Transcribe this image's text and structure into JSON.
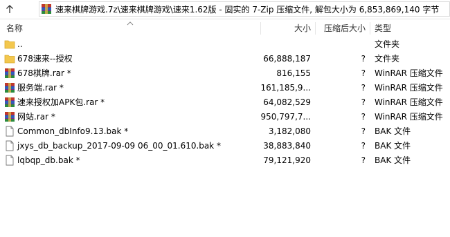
{
  "window": {
    "path": "速来棋牌游戏.7z\\速来棋牌游戏\\速来1.62版 - 固实的 7-Zip 压缩文件, 解包大小为 6,853,869,140 字节",
    "up_icon": "up-arrow-icon",
    "archive_icon": "winrar-archive-icon"
  },
  "columns": {
    "name": "名称",
    "size": "大小",
    "packed": "压缩后大小",
    "type": "类型"
  },
  "rows": [
    {
      "name": "..",
      "size": "",
      "packed": "",
      "type": "文件夹",
      "icon": "folder-icon"
    },
    {
      "name": "678速来--授权",
      "size": "66,888,187",
      "packed": "?",
      "type": "文件夹",
      "icon": "folder-icon"
    },
    {
      "name": "678棋牌.rar *",
      "size": "816,155",
      "packed": "?",
      "type": "WinRAR 压缩文件",
      "icon": "winrar-archive-icon"
    },
    {
      "name": "服务端.rar *",
      "size": "161,185,9...",
      "packed": "?",
      "type": "WinRAR 压缩文件",
      "icon": "winrar-archive-icon"
    },
    {
      "name": "速来授权加APK包.rar *",
      "size": "64,082,529",
      "packed": "?",
      "type": "WinRAR 压缩文件",
      "icon": "winrar-archive-icon"
    },
    {
      "name": "网站.rar *",
      "size": "950,797,7...",
      "packed": "?",
      "type": "WinRAR 压缩文件",
      "icon": "winrar-archive-icon"
    },
    {
      "name": "Common_dbInfo9.13.bak *",
      "size": "3,182,080",
      "packed": "?",
      "type": "BAK 文件",
      "icon": "file-icon"
    },
    {
      "name": "jxys_db_backup_2017-09-09 06_00_01.610.bak *",
      "size": "38,883,840",
      "packed": "?",
      "type": "BAK 文件",
      "icon": "file-icon"
    },
    {
      "name": "lqbqp_db.bak *",
      "size": "79,121,920",
      "packed": "?",
      "type": "BAK 文件",
      "icon": "file-icon"
    }
  ]
}
